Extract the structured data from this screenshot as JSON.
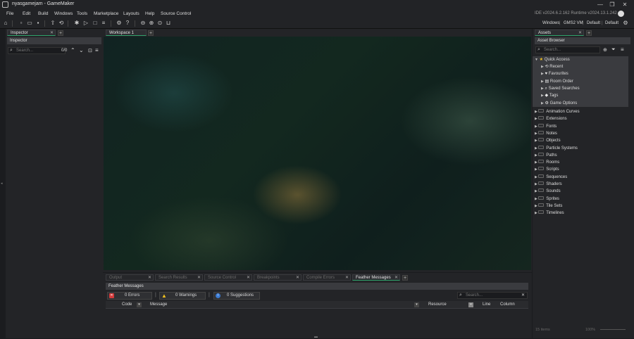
{
  "window": {
    "title": "nyasgamejam - GameMaker",
    "controls": {
      "minimize": "—",
      "maximize": "❐",
      "close": "✕"
    }
  },
  "menu": {
    "items": [
      "File",
      "Edit",
      "Build",
      "Windows",
      "Tools",
      "Marketplace",
      "Layouts",
      "Help",
      "Source Control"
    ],
    "version": "IDE v2024.6.2.162  Runtime v2024.13.1.242"
  },
  "toolbar": {
    "target": {
      "platform": "Windows",
      "vm": "GMS2 VM",
      "config1": "Default",
      "config2": "Default"
    }
  },
  "inspector": {
    "tab_label": "Inspector",
    "header": "Inspector",
    "search_placeholder": "Search...",
    "count": "0/0"
  },
  "workspace": {
    "tab_label": "Workspace 1"
  },
  "assets": {
    "tab_label": "Assets",
    "header": "Asset Browser",
    "search_placeholder": "Search...",
    "quick_access": {
      "label": "Quick Access",
      "items": [
        "Recent",
        "Favourites",
        "Room Order",
        "Saved Searches",
        "Tags",
        "Game Options"
      ]
    },
    "folders": [
      "Animation Curves",
      "Extensions",
      "Fonts",
      "Notes",
      "Objects",
      "Particle Systems",
      "Paths",
      "Rooms",
      "Scripts",
      "Sequences",
      "Shaders",
      "Sounds",
      "Sprites",
      "Tile Sets",
      "Timelines"
    ],
    "footer_items": "15 items",
    "footer_zoom": "100%"
  },
  "bottom": {
    "tabs": [
      "Output",
      "Search Results",
      "Source Control",
      "Breakpoints",
      "Compile Errors",
      "Feather Messages"
    ],
    "active_tab": "Feather Messages",
    "header": "Feather Messages",
    "errors": "0 Errors",
    "warnings": "0 Warnings",
    "suggestions": "0 Suggestions",
    "search_placeholder": "Search...",
    "columns": {
      "code": "Code",
      "message": "Message",
      "resource": "Resource",
      "line": "Line",
      "column": "Column"
    }
  }
}
